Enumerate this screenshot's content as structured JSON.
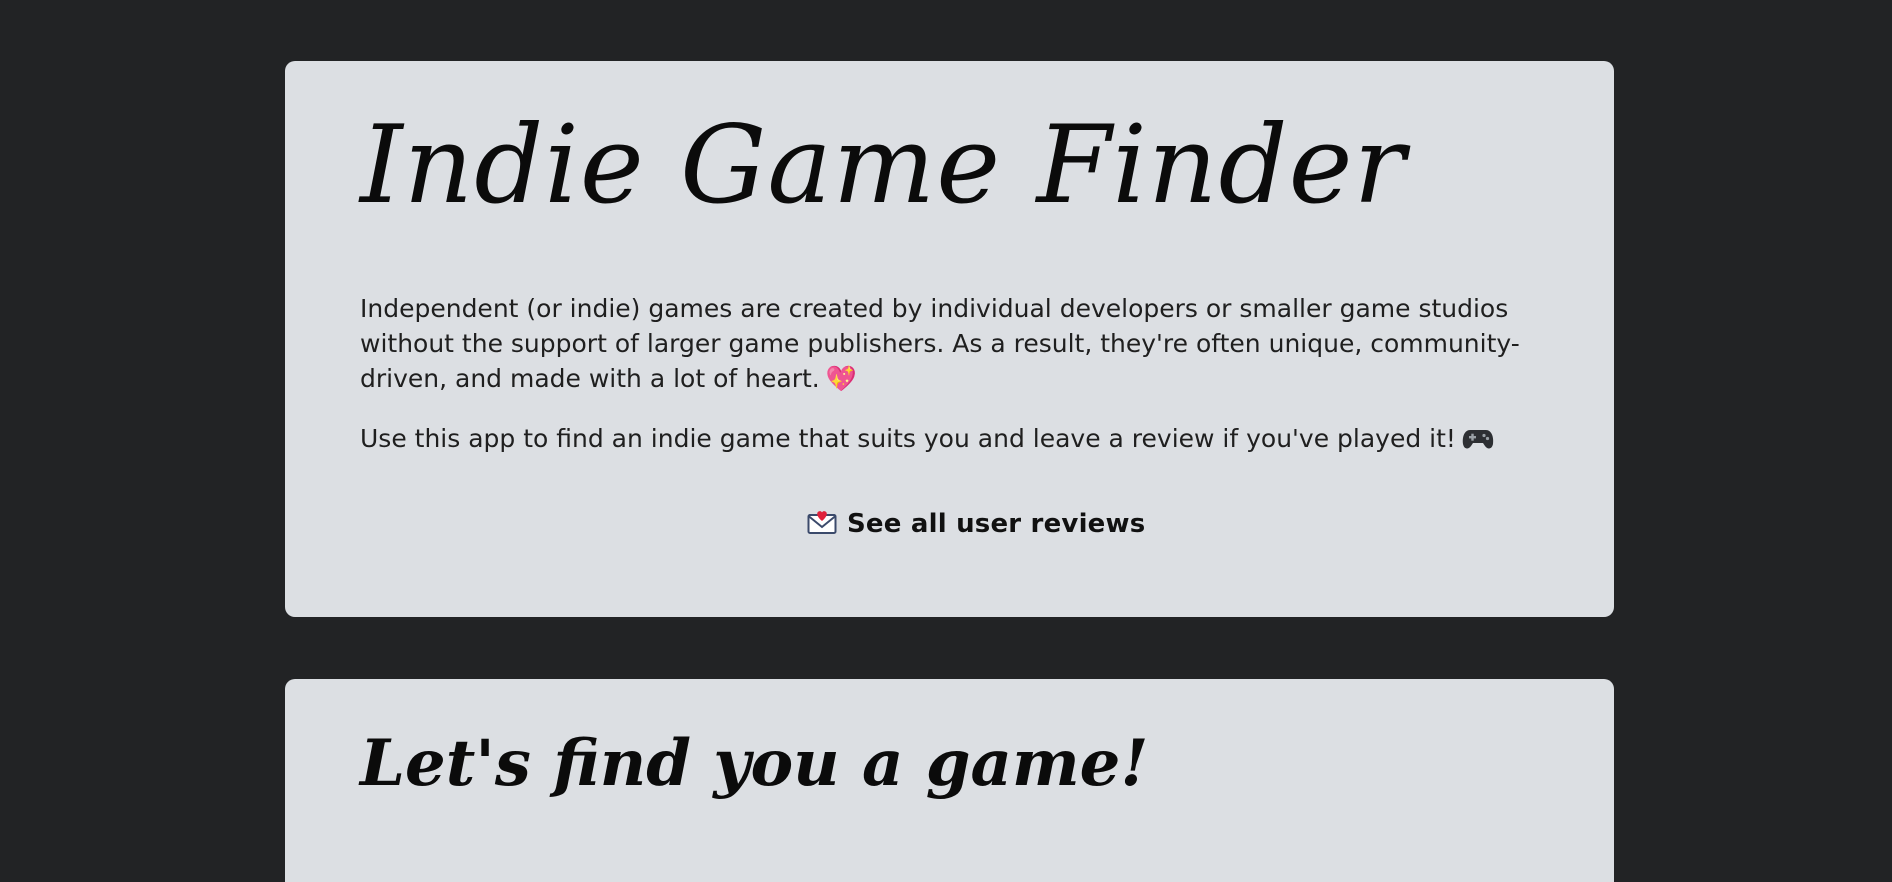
{
  "intro": {
    "title": "Indie Game Finder",
    "paragraph1": "Independent (or indie) games are created by individual developers or smaller game studios without the support of larger game publishers. As a result, they're often unique, community-driven, and made with a lot of heart.",
    "paragraph1_emoji": "💖",
    "paragraph2": "Use this app to find an indie game that suits you and leave a review if you've played it!",
    "paragraph2_icon": "gamepad-icon",
    "reviews_link": {
      "icon": "love-letter-icon",
      "label": "See all user reviews"
    }
  },
  "finder": {
    "title": "Let's find you a game!"
  },
  "colors": {
    "background": "#222325",
    "card": "#dcdfe3",
    "text": "#1f1f1f",
    "heart": "#d8223a"
  }
}
